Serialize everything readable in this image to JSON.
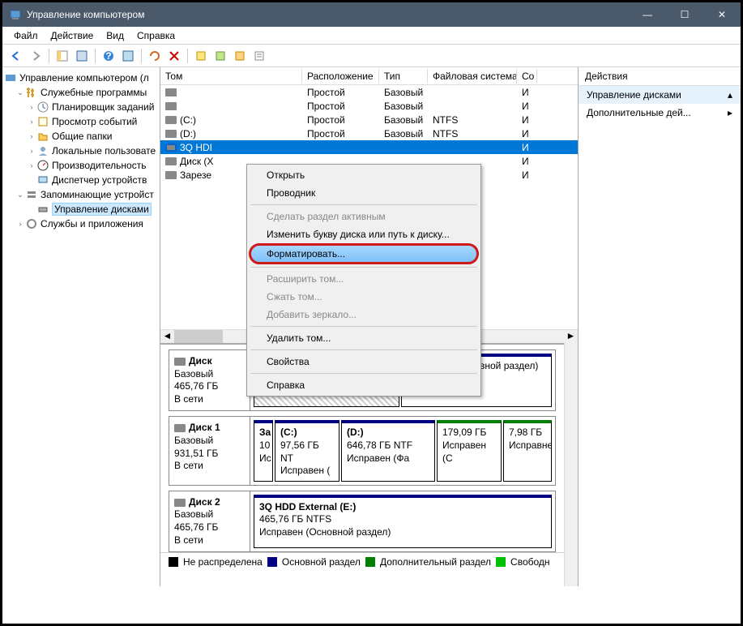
{
  "window": {
    "title": "Управление компьютером"
  },
  "winbtns": {
    "min": "—",
    "max": "☐",
    "close": "✕"
  },
  "menu": {
    "file": "Файл",
    "action": "Действие",
    "view": "Вид",
    "help": "Справка"
  },
  "tree": {
    "root": "Управление компьютером (л",
    "systools": "Служебные программы",
    "scheduler": "Планировщик заданий",
    "eventviewer": "Просмотр событий",
    "sharedfolders": "Общие папки",
    "localusers": "Локальные пользовате",
    "performance": "Производительность",
    "devmgr": "Диспетчер устройств",
    "storage": "Запоминающие устройст",
    "diskmgmt": "Управление дисками",
    "services": "Службы и приложения"
  },
  "volcols": {
    "tom": "Том",
    "rasp": "Расположение",
    "tip": "Тип",
    "fs": "Файловая система",
    "st": "Со"
  },
  "vols": [
    {
      "name": "",
      "layout": "Простой",
      "type": "Базовый",
      "fs": "",
      "st": "И"
    },
    {
      "name": "",
      "layout": "Простой",
      "type": "Базовый",
      "fs": "",
      "st": "И"
    },
    {
      "name": "(C:)",
      "layout": "Простой",
      "type": "Базовый",
      "fs": "NTFS",
      "st": "И"
    },
    {
      "name": "(D:)",
      "layout": "Простой",
      "type": "Базовый",
      "fs": "NTFS",
      "st": "И"
    },
    {
      "name": "3Q HDI",
      "layout": "",
      "type": "",
      "fs": "",
      "st": "И"
    },
    {
      "name": "Диск (X",
      "layout": "",
      "type": "",
      "fs": "",
      "st": "И"
    },
    {
      "name": "Зарезе",
      "layout": "",
      "type": "",
      "fs": "",
      "st": "И"
    }
  ],
  "ctx": {
    "open": "Открыть",
    "explorer": "Проводник",
    "makeactive": "Сделать раздел активным",
    "changeletter": "Изменить букву диска или путь к диску...",
    "format": "Форматировать...",
    "extend": "Расширить том...",
    "shrink": "Сжать том...",
    "mirror": "Добавить зеркало...",
    "delete": "Удалить том...",
    "properties": "Свойства",
    "help": "Справка"
  },
  "disks": {
    "d0": {
      "name": "Диск",
      "type": "Базовый",
      "size": "465,76 ГБ",
      "status": "В сети",
      "p1": {
        "status": "Исправен (Основной раздел)"
      }
    },
    "d1": {
      "name": "Диск 1",
      "type": "Базовый",
      "size": "931,51 ГБ",
      "status": "В сети",
      "p1": {
        "name": "За",
        "size": "10",
        "status": "Ис"
      },
      "p2": {
        "name": "(C:)",
        "size": "97,56 ГБ NT",
        "status": "Исправен ("
      },
      "p3": {
        "name": "(D:)",
        "size": "646,78 ГБ NTF",
        "status": "Исправен (Фа"
      },
      "p4": {
        "name": "",
        "size": "179,09 ГБ",
        "status": "Исправен (С"
      },
      "p5": {
        "name": "",
        "size": "7,98 ГБ",
        "status": "Исправне"
      }
    },
    "d2": {
      "name": "Диск 2",
      "type": "Базовый",
      "size": "465,76 ГБ",
      "status": "В сети",
      "p1": {
        "name": "3Q HDD External  (E:)",
        "size": "465,76 ГБ NTFS",
        "status": "Исправен (Основной раздел)"
      }
    }
  },
  "legend": {
    "unalloc": "Не распределена",
    "primary": "Основной раздел",
    "ext": "Дополнительный раздел",
    "free": "Свободн"
  },
  "actions": {
    "header": "Действия",
    "diskmgmt": "Управление дисками",
    "more": "Дополнительные дей..."
  }
}
